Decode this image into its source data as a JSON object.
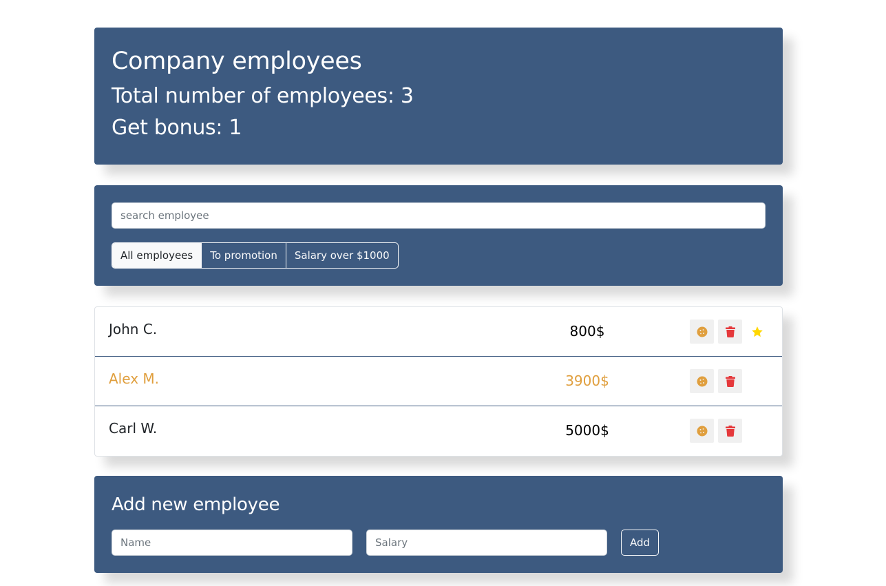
{
  "app_info": {
    "title": "Company employees",
    "total_label": "Total number of employees: 3",
    "bonus_label": "Get bonus: 1"
  },
  "search": {
    "placeholder": "search employee",
    "value": ""
  },
  "filters": {
    "all": "All employees",
    "promotion": "To promotion",
    "salary_over": "Salary over $1000",
    "active": "all"
  },
  "employees": [
    {
      "name": "John C.",
      "salary": "800$",
      "increase": false,
      "rise": true
    },
    {
      "name": "Alex M.",
      "salary": "3900$",
      "increase": true,
      "rise": false
    },
    {
      "name": "Carl W.",
      "salary": "5000$",
      "increase": false,
      "rise": false
    }
  ],
  "add_form": {
    "title": "Add new employee",
    "name_placeholder": "Name",
    "salary_placeholder": "Salary",
    "submit_label": "Add"
  },
  "colors": {
    "panel": "#3d5a80",
    "accent": "#e09f3e",
    "delete": "#e5383b",
    "star": "#ffd700"
  },
  "icons": {
    "increase": "cookie-icon",
    "delete": "trash-icon",
    "rise": "star-icon"
  }
}
